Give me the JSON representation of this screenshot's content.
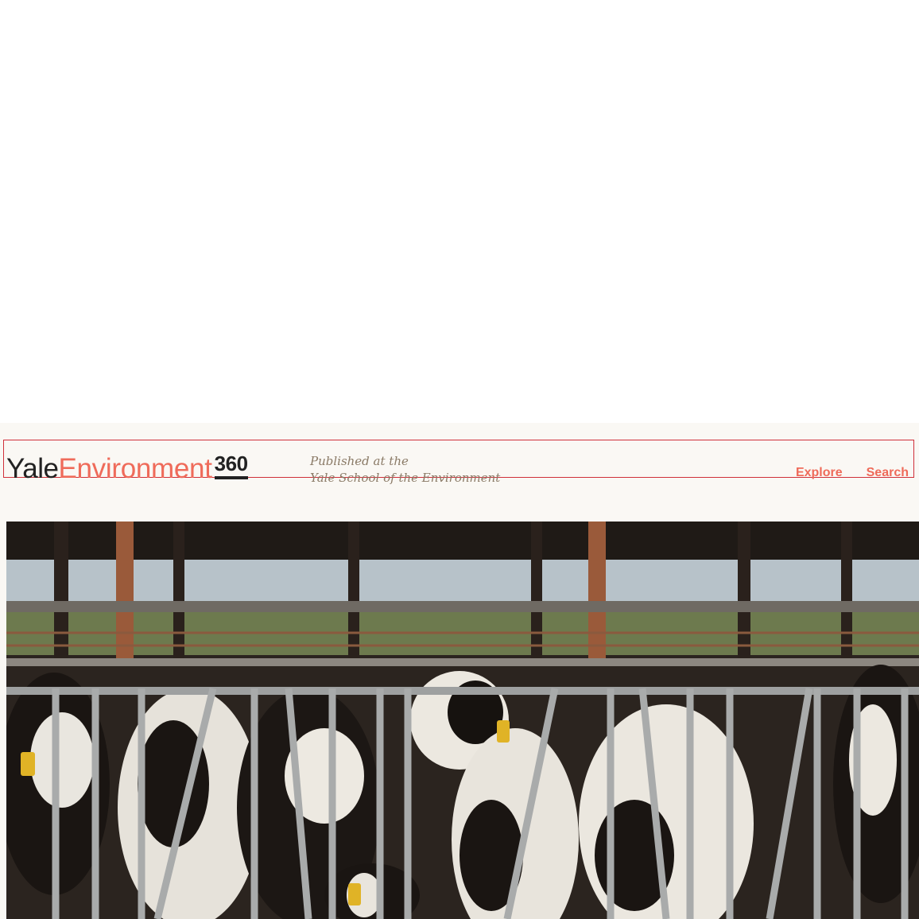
{
  "brand": {
    "yale": "Yale",
    "environment": "Environment",
    "number": "360",
    "accent_color": "#ef6b5a",
    "dark_color": "#222222"
  },
  "tagline": {
    "line1": "Published at the",
    "line2": "Yale School of the Environment"
  },
  "nav": {
    "explore_label": "Explore",
    "search_label": "Search"
  },
  "hero": {
    "icon": "hero-photo",
    "subject": "dairy-cows-in-feeding-stalls"
  }
}
